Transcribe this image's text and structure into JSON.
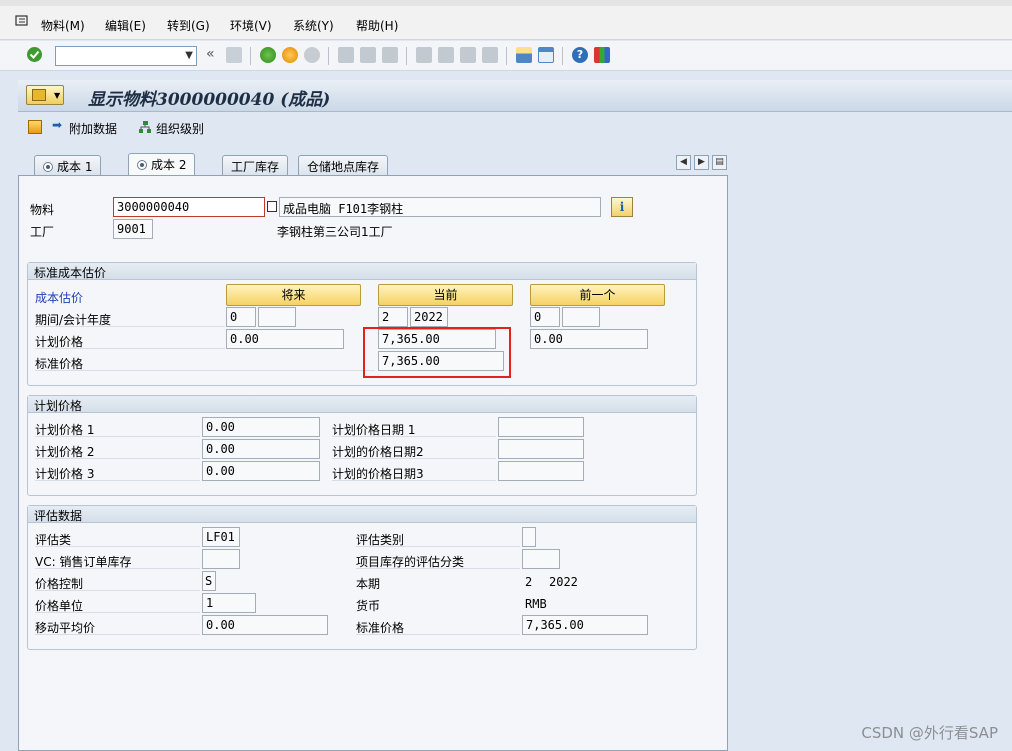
{
  "menubar": {
    "items": [
      "物料(M)",
      "编辑(E)",
      "转到(G)",
      "环境(V)",
      "系统(Y)",
      "帮助(H)"
    ]
  },
  "toolbar": {
    "command_field_value": "",
    "icons": [
      "enter-icon",
      "save-icon",
      "back-icon",
      "exit-icon",
      "cancel-icon",
      "print-icon",
      "find-icon",
      "find-next-icon",
      "first-page-icon",
      "prev-page-icon",
      "next-page-icon",
      "last-page-icon",
      "new-session-icon",
      "shortcut-icon",
      "help-icon",
      "customize-layout-icon"
    ]
  },
  "title": "显示物料3000000040 (成品)",
  "app_toolbar": {
    "additional_data": "附加数据",
    "org_levels": "组织级别"
  },
  "tabs": [
    "成本 1",
    "成本 2",
    "工厂库存",
    "仓储地点库存"
  ],
  "header": {
    "material_label": "物料",
    "material_value": "3000000040",
    "material_desc": "成品电脑 F101李钢柱",
    "plant_label": "工厂",
    "plant_value": "9001",
    "plant_desc": "李钢柱第三公司1工厂"
  },
  "std_cost": {
    "title": "标准成本估价",
    "cost_estimate_label": "成本估价",
    "btn_future": "将来",
    "btn_current": "当前",
    "btn_previous": "前一个",
    "period_label": "期间/会计年度",
    "planned_price_label": "计划价格",
    "standard_price_label": "标准价格",
    "future_period": "0",
    "future_year": "",
    "future_planned": "0.00",
    "current_period": "2",
    "current_year": "2022",
    "current_planned": "7,365.00",
    "current_standard": "7,365.00",
    "prev_period": "0",
    "prev_year": "",
    "prev_planned": "0.00"
  },
  "planned": {
    "title": "计划价格",
    "p1_label": "计划价格 1",
    "p1_value": "0.00",
    "p2_label": "计划价格 2",
    "p2_value": "0.00",
    "p3_label": "计划价格 3",
    "p3_value": "0.00",
    "d1_label": "计划价格日期 1",
    "d2_label": "计划的价格日期2",
    "d3_label": "计划的价格日期3"
  },
  "valuation": {
    "title": "评估数据",
    "val_class_label": "评估类",
    "val_class_value": "LF01",
    "vc_label": "VC: 销售订单库存",
    "vc_value": "",
    "price_control_label": "价格控制",
    "price_control_value": "S",
    "price_unit_label": "价格单位",
    "price_unit_value": "1",
    "mov_avg_label": "移动平均价",
    "mov_avg_value": "0.00",
    "val_cat_label": "评估类别",
    "val_cat_value": "",
    "proj_stock_label": "项目库存的评估分类",
    "proj_stock_value": "",
    "current_period_label": "本期",
    "current_period_value": "2",
    "current_year_value": "2022",
    "currency_label": "货币",
    "currency_value": "RMB",
    "std_price_label": "标准价格",
    "std_price_value": "7,365.00"
  },
  "watermark": "CSDN @外行看SAP"
}
